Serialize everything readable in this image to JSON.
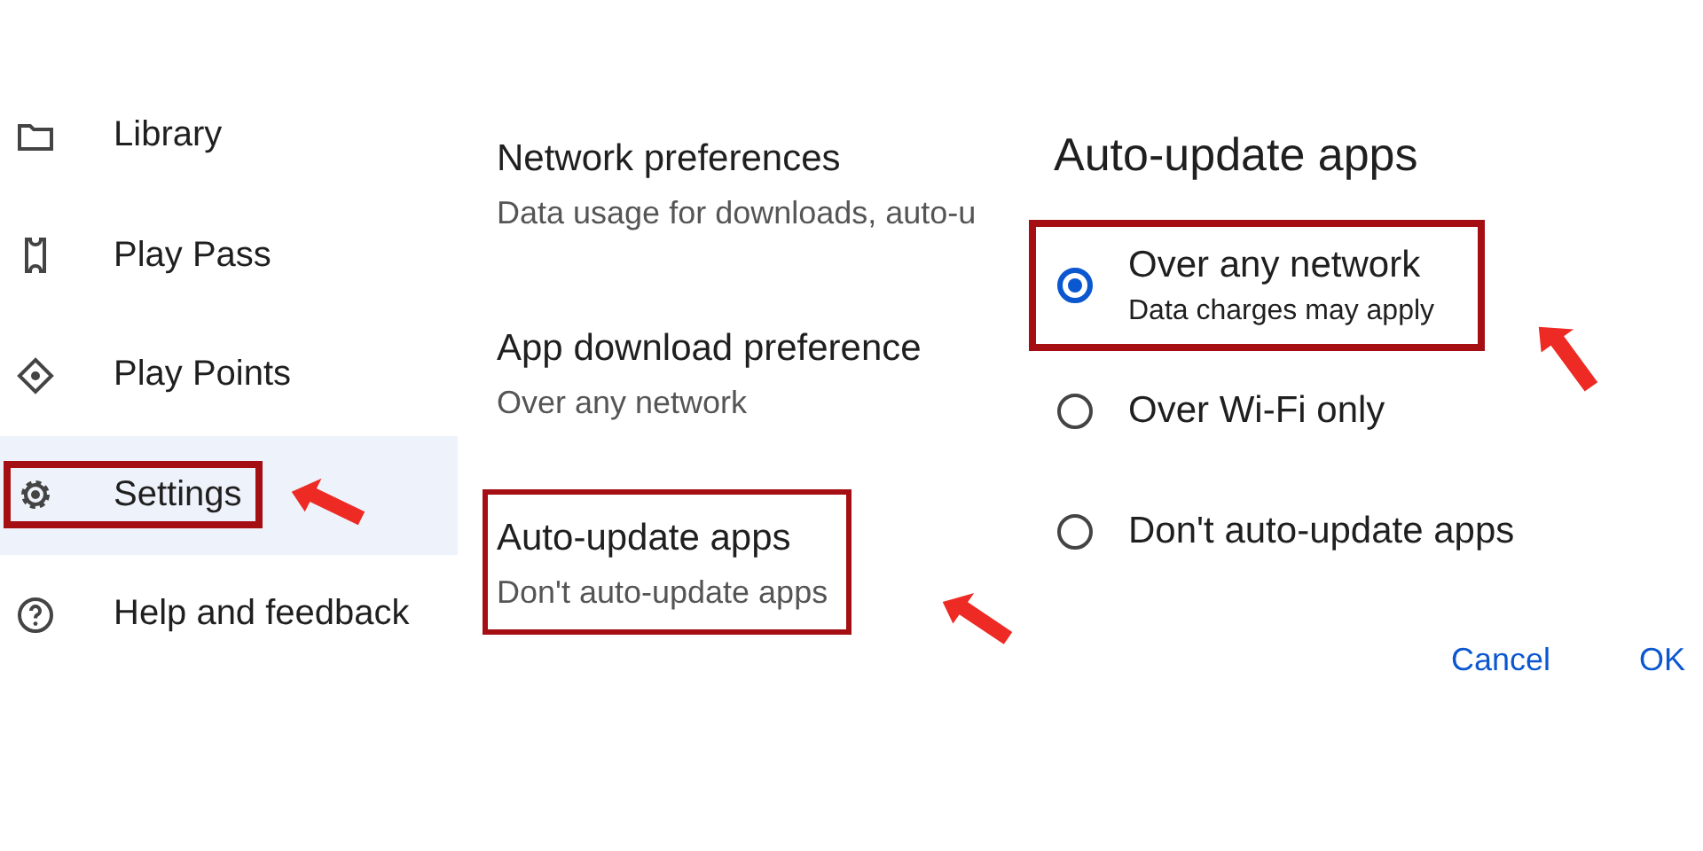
{
  "sidebar": {
    "items": [
      {
        "label": "Library",
        "selected": false,
        "highlighted": false
      },
      {
        "label": "Play Pass",
        "selected": false,
        "highlighted": false
      },
      {
        "label": "Play Points",
        "selected": false,
        "highlighted": false
      },
      {
        "label": "Settings",
        "selected": true,
        "highlighted": true
      },
      {
        "label": "Help and feedback",
        "selected": false,
        "highlighted": false
      }
    ]
  },
  "settings": {
    "items": [
      {
        "title": "Network preferences",
        "subtitle": "Data usage for downloads, auto-u",
        "highlighted": false
      },
      {
        "title": "App download preference",
        "subtitle": "Over any network",
        "highlighted": false
      },
      {
        "title": "Auto-update apps",
        "subtitle": "Don't auto-update apps",
        "highlighted": true
      }
    ]
  },
  "dialog": {
    "title": "Auto-update apps",
    "options": [
      {
        "label": "Over any network",
        "subtitle": "Data charges may apply",
        "selected": true,
        "highlighted": true
      },
      {
        "label": "Over Wi-Fi only",
        "selected": false,
        "highlighted": false
      },
      {
        "label": "Don't auto-update apps",
        "selected": false,
        "highlighted": false
      }
    ],
    "buttons": [
      "Cancel",
      "OK"
    ]
  }
}
